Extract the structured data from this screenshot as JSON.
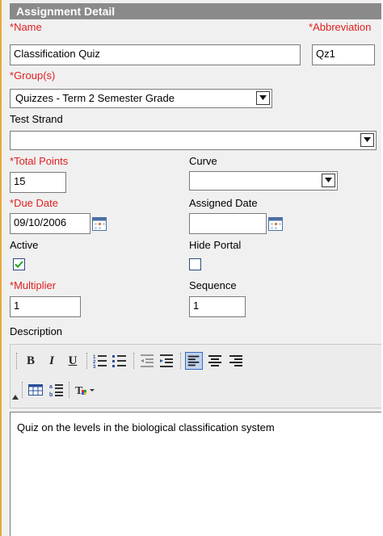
{
  "header": {
    "title": "Assignment Detail"
  },
  "fields": {
    "name": {
      "label": "Name",
      "value": "Classification Quiz"
    },
    "abbreviation": {
      "label": "Abbreviation",
      "value": "Qz1"
    },
    "group": {
      "label": "Group(s)",
      "value": "Quizzes - Term 2 Semester Grade"
    },
    "test_strand": {
      "label": "Test Strand",
      "value": ""
    },
    "total_points": {
      "label": "Total Points",
      "value": "15"
    },
    "curve": {
      "label": "Curve",
      "value": ""
    },
    "due_date": {
      "label": "Due Date",
      "value": "09/10/2006"
    },
    "assigned_date": {
      "label": "Assigned Date",
      "value": ""
    },
    "active": {
      "label": "Active",
      "checked": true
    },
    "hide_portal": {
      "label": "Hide Portal",
      "checked": false
    },
    "multiplier": {
      "label": "Multiplier",
      "value": "1"
    },
    "sequence": {
      "label": "Sequence",
      "value": "1"
    },
    "description": {
      "label": "Description",
      "value": "Quiz on the levels in the biological classification system"
    }
  },
  "required_marker": "*",
  "colors": {
    "required": "#e02020",
    "header": "#8a8a8a",
    "panel_border": "#e8a93a"
  },
  "toolbar_icons": [
    "bold-icon",
    "italic-icon",
    "underline-icon",
    "numbered-list-icon",
    "bullet-list-icon",
    "outdent-icon",
    "indent-icon",
    "align-left-icon",
    "align-center-icon",
    "align-right-icon",
    "table-icon",
    "paragraph-icon",
    "text-color-icon"
  ],
  "toolbar_labels": {
    "bold": "B",
    "italic": "I",
    "underline": "U"
  }
}
